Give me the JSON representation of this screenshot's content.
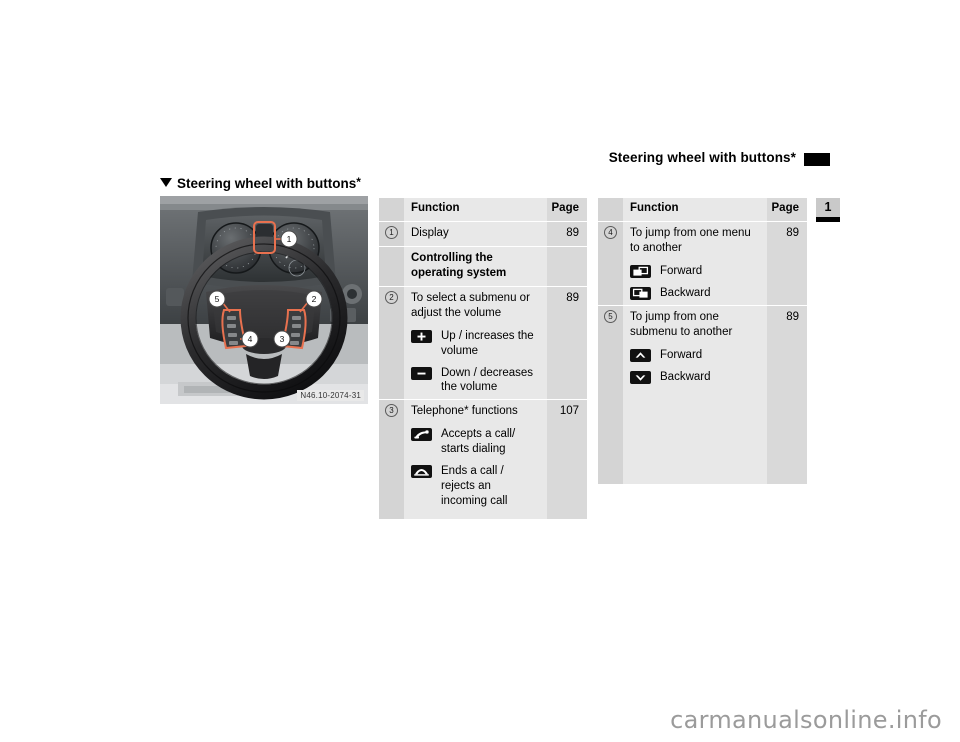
{
  "header": {
    "running_title": "Steering wheel with buttons*",
    "marker_icon": "black-bar-marker"
  },
  "section": {
    "bullet_icon": "triangle-down-icon",
    "title": "Steering wheel with buttons",
    "star": "*"
  },
  "chapter_tab": {
    "number": "1"
  },
  "figure": {
    "name": "steering-wheel-with-buttons-illustration",
    "caption": "N46.10-2074-31",
    "callouts": [
      "1",
      "2",
      "3",
      "4",
      "5"
    ]
  },
  "tables": [
    {
      "id": "left",
      "columns": {
        "marker": "",
        "function": "Function",
        "page": "Page"
      },
      "rows": [
        {
          "type": "entry",
          "marker": "1",
          "text": "Display",
          "page": "89",
          "sub": []
        },
        {
          "type": "bold",
          "marker": "",
          "text": "Controlling the operating system",
          "page": "",
          "sub": []
        },
        {
          "type": "entry",
          "marker": "2",
          "text": "To select a submenu or adjust the volume",
          "page": "89",
          "sub": [
            {
              "icon": "plus-button-icon",
              "label": "Up / increases the volume"
            },
            {
              "icon": "minus-button-icon",
              "label": "Down / decreases the volume"
            }
          ]
        },
        {
          "type": "entry",
          "marker": "3",
          "text": "Telephone* functions",
          "page": "107",
          "sub": [
            {
              "icon": "phone-accept-icon",
              "label": "Accepts a call/ starts dialing"
            },
            {
              "icon": "phone-end-icon",
              "label": "Ends a call / rejects an incoming call"
            }
          ]
        }
      ]
    },
    {
      "id": "right",
      "columns": {
        "marker": "",
        "function": "Function",
        "page": "Page"
      },
      "rows": [
        {
          "type": "entry",
          "marker": "4",
          "text": "To jump from one menu to another",
          "page": "89",
          "sub": [
            {
              "icon": "window-forward-icon",
              "label": "Forward"
            },
            {
              "icon": "window-backward-icon",
              "label": "Backward"
            }
          ]
        },
        {
          "type": "entry",
          "marker": "5",
          "text": "To jump from one submenu to another",
          "page": "89",
          "sub": [
            {
              "icon": "arrow-up-button-icon",
              "label": "Forward"
            },
            {
              "icon": "arrow-down-button-icon",
              "label": "Backward"
            }
          ]
        }
      ]
    }
  ],
  "watermark": {
    "text": "carmanualsonline.info"
  },
  "colors": {
    "table_body": "#e8e8e8",
    "table_marker_col": "#d4d4d4",
    "table_page_col": "#d9d9d9",
    "callout_accent": "#e8714f",
    "icon_black": "#111111"
  }
}
